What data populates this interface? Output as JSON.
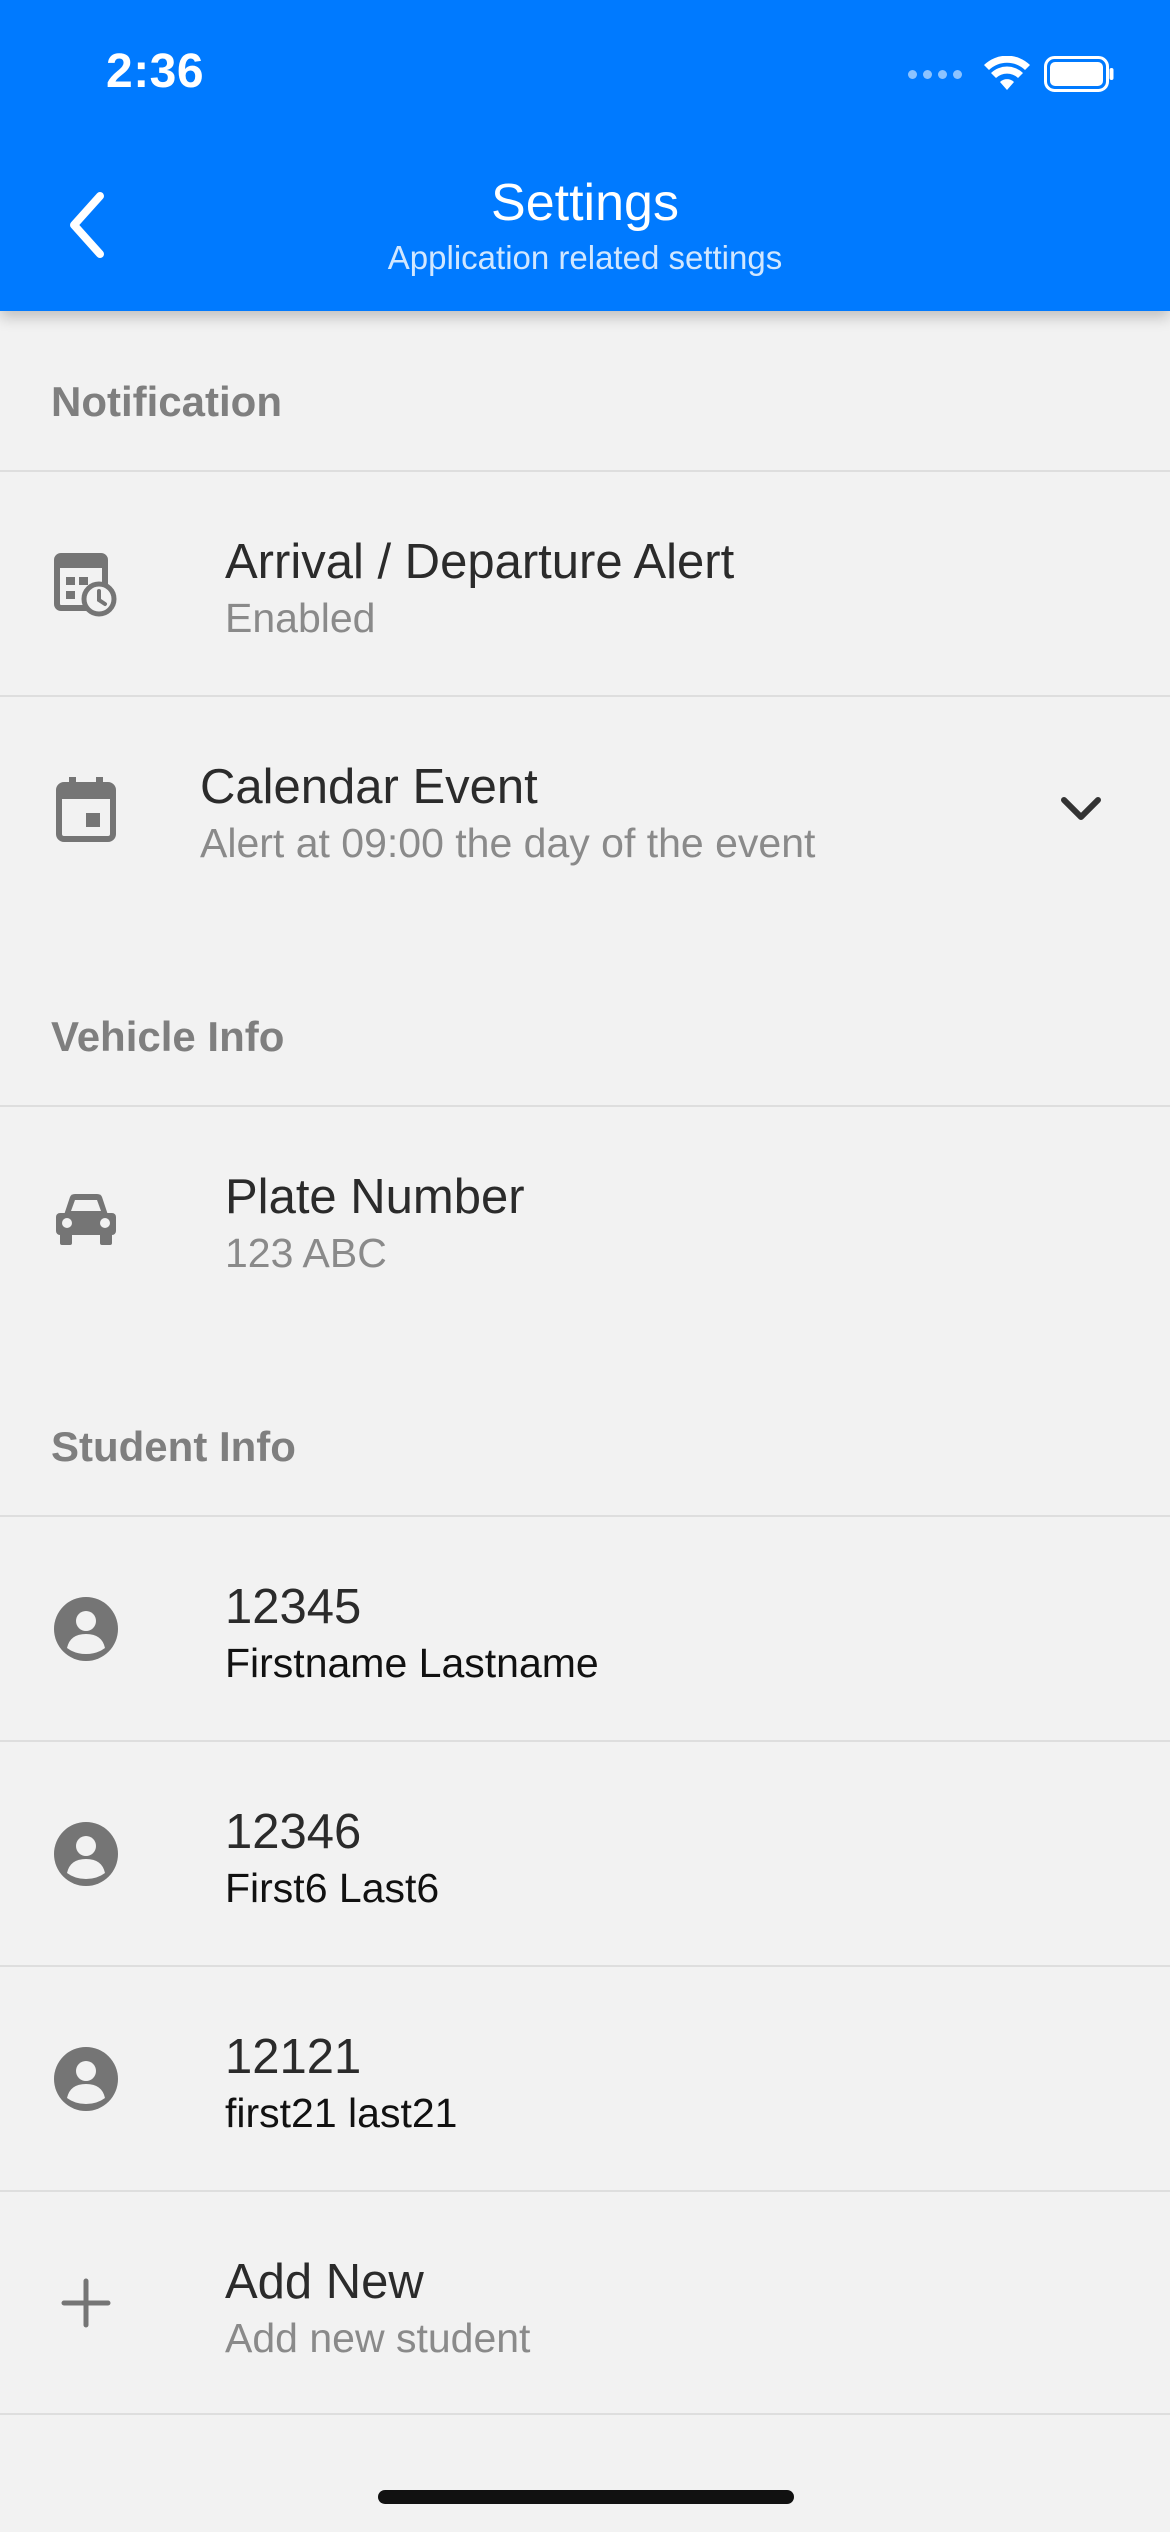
{
  "status_bar": {
    "time": "2:36"
  },
  "header": {
    "title": "Settings",
    "subtitle": "Application related settings"
  },
  "sections": {
    "notification": {
      "label": "Notification",
      "items": [
        {
          "icon": "calendar-clock-icon",
          "title": "Arrival / Departure Alert",
          "subtitle": "Enabled"
        },
        {
          "icon": "calendar-icon",
          "title": "Calendar Event",
          "subtitle": "Alert at 09:00 the day of the event"
        }
      ]
    },
    "vehicle": {
      "label": "Vehicle Info",
      "items": [
        {
          "icon": "car-icon",
          "title": "Plate Number",
          "subtitle": "123 ABC"
        }
      ]
    },
    "student": {
      "label": "Student Info",
      "items": [
        {
          "icon": "person-icon",
          "title": "12345",
          "subtitle": "Firstname Lastname"
        },
        {
          "icon": "person-icon",
          "title": "12346",
          "subtitle": "First6 Last6"
        },
        {
          "icon": "person-icon",
          "title": "12121",
          "subtitle": "first21 last21"
        },
        {
          "icon": "plus-icon",
          "title": "Add New",
          "subtitle": "Add new student"
        }
      ]
    }
  },
  "colors": {
    "header_bg": "#007aff",
    "page_bg": "#f2f2f2",
    "icon_gray": "#757575"
  }
}
